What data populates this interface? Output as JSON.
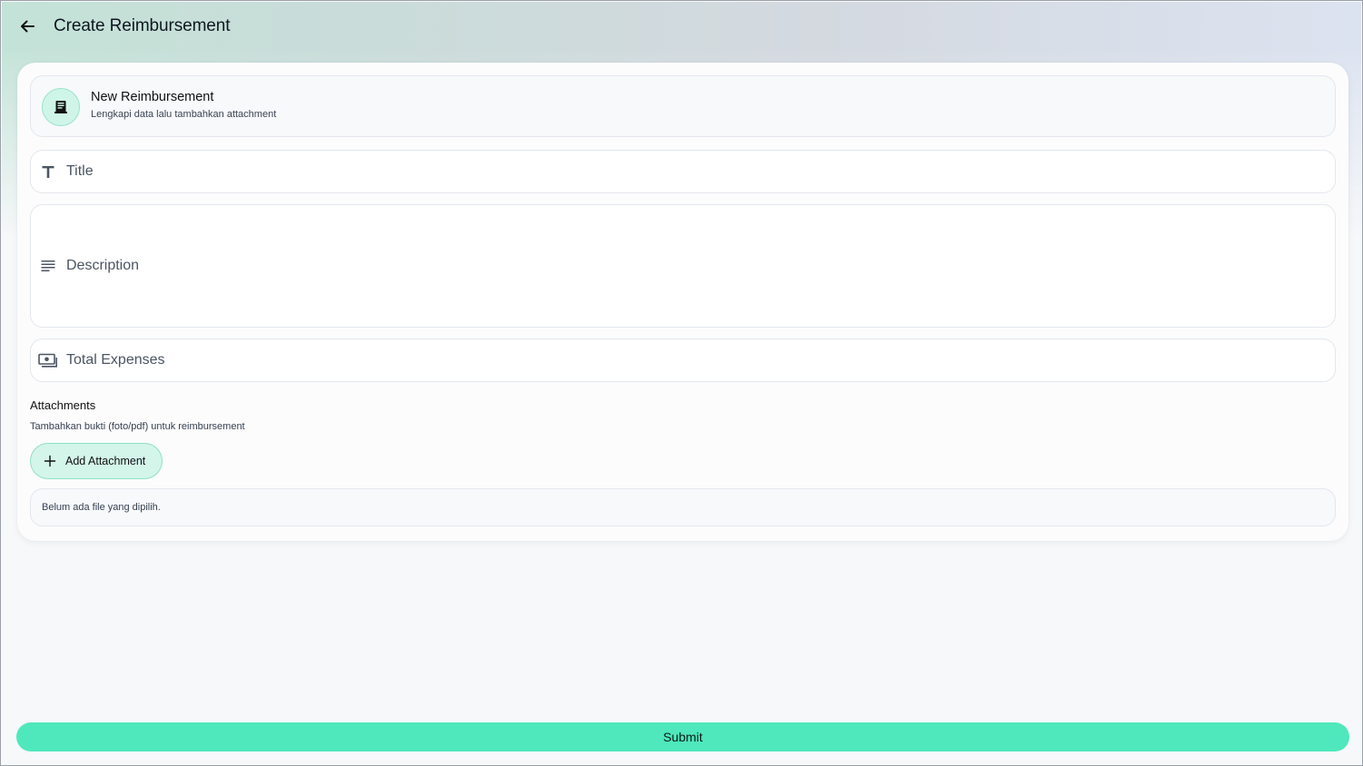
{
  "header": {
    "title": "Create Reimbursement"
  },
  "intro": {
    "title": "New Reimbursement",
    "subtitle": "Lengkapi data lalu tambahkan attachment"
  },
  "form": {
    "title_placeholder": "Title",
    "description_placeholder": "Description",
    "total_expenses_placeholder": "Total Expenses"
  },
  "attachments": {
    "heading": "Attachments",
    "subtitle": "Tambahkan bukti (foto/pdf) untuk reimbursement",
    "add_label": "Add Attachment",
    "empty_text": "Belum ada file yang dipilih."
  },
  "footer": {
    "submit_label": "Submit"
  },
  "colors": {
    "accent": "#4fe8bc",
    "accent_light": "#d4f5ea"
  },
  "icons": {
    "back": "arrow-left-icon",
    "intro": "receipt-icon",
    "title": "text-t-icon",
    "description": "lines-icon",
    "total": "money-icon",
    "add": "plus-icon"
  }
}
